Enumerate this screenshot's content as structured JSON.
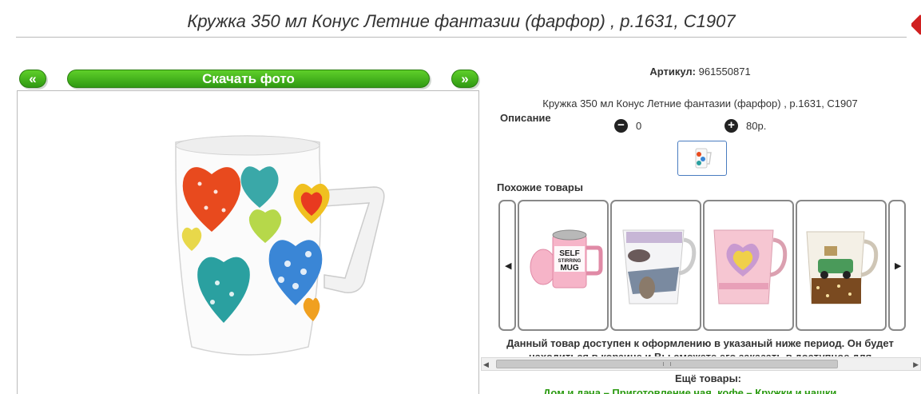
{
  "title": "Кружка 350 мл Конус Летние фантазии (фарфор) , р.1631, С1907",
  "photo_nav": {
    "prev_label": "«",
    "download_label": "Скачать фото",
    "next_label": "»"
  },
  "product": {
    "sku_label": "Артикул:",
    "sku_value": "961550871",
    "description_text": "Кружка 350 мл Конус Летние фантазии (фарфор) , р.1631, С1907",
    "description_label": "Описание",
    "quantity": "0",
    "price": "80р."
  },
  "similar": {
    "title": "Похожие товары",
    "items": [
      {
        "name": "self-stirring-mug",
        "text1": "SELF",
        "text2": "STIRRING",
        "text3": "MUG"
      },
      {
        "name": "fashion-mug"
      },
      {
        "name": "pink-heart-mug"
      },
      {
        "name": "car-mug"
      }
    ]
  },
  "availability_text": "Данный товар доступен к оформлению в указаный ниже период. Он будет",
  "availability_text2": "находиться в корзине и Вы сможете его заказать в доступное для",
  "more": {
    "title": "Ещё товары:",
    "links": "Дом и дача – Приготовление чая, кофе – Кружки и чашки"
  },
  "colors": {
    "accent_green": "#2f9a12",
    "link_green": "#2a9a10",
    "corner_red": "#d02020"
  }
}
